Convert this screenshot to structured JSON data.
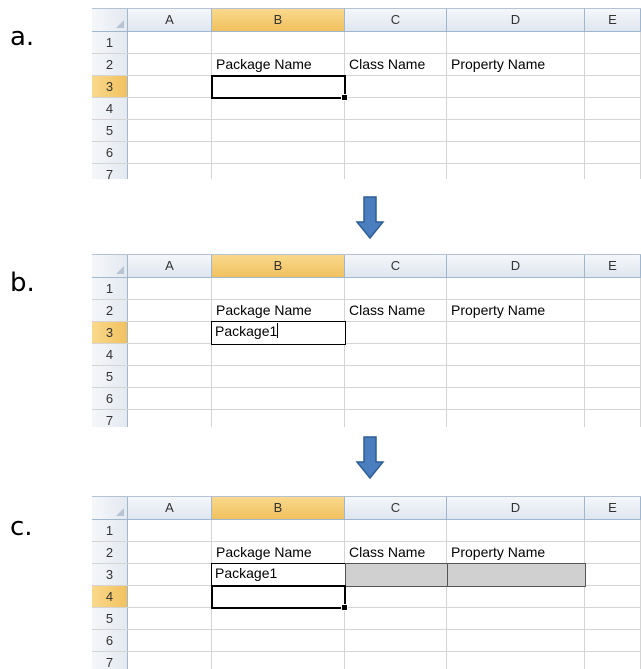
{
  "steps": [
    {
      "label": "a.",
      "active_row": "3",
      "active_cell_value": ""
    },
    {
      "label": "b.",
      "active_row": "3",
      "editing_value": "Package1"
    },
    {
      "label": "c.",
      "active_row": "4",
      "entered_value": "Package1"
    }
  ],
  "columns": [
    "A",
    "B",
    "C",
    "D",
    "E"
  ],
  "rows": [
    "1",
    "2",
    "3",
    "4",
    "5",
    "6",
    "7"
  ],
  "headers": {
    "package_name": "Package Name",
    "class_name": "Class Name",
    "property_name": "Property Name"
  },
  "colors": {
    "selected_header": "#f1c15f",
    "arrow": "#4a7ebf",
    "shaded_cell": "#d0d0d0"
  },
  "icons": [
    "down-arrow-icon",
    "select-all-corner-icon"
  ]
}
